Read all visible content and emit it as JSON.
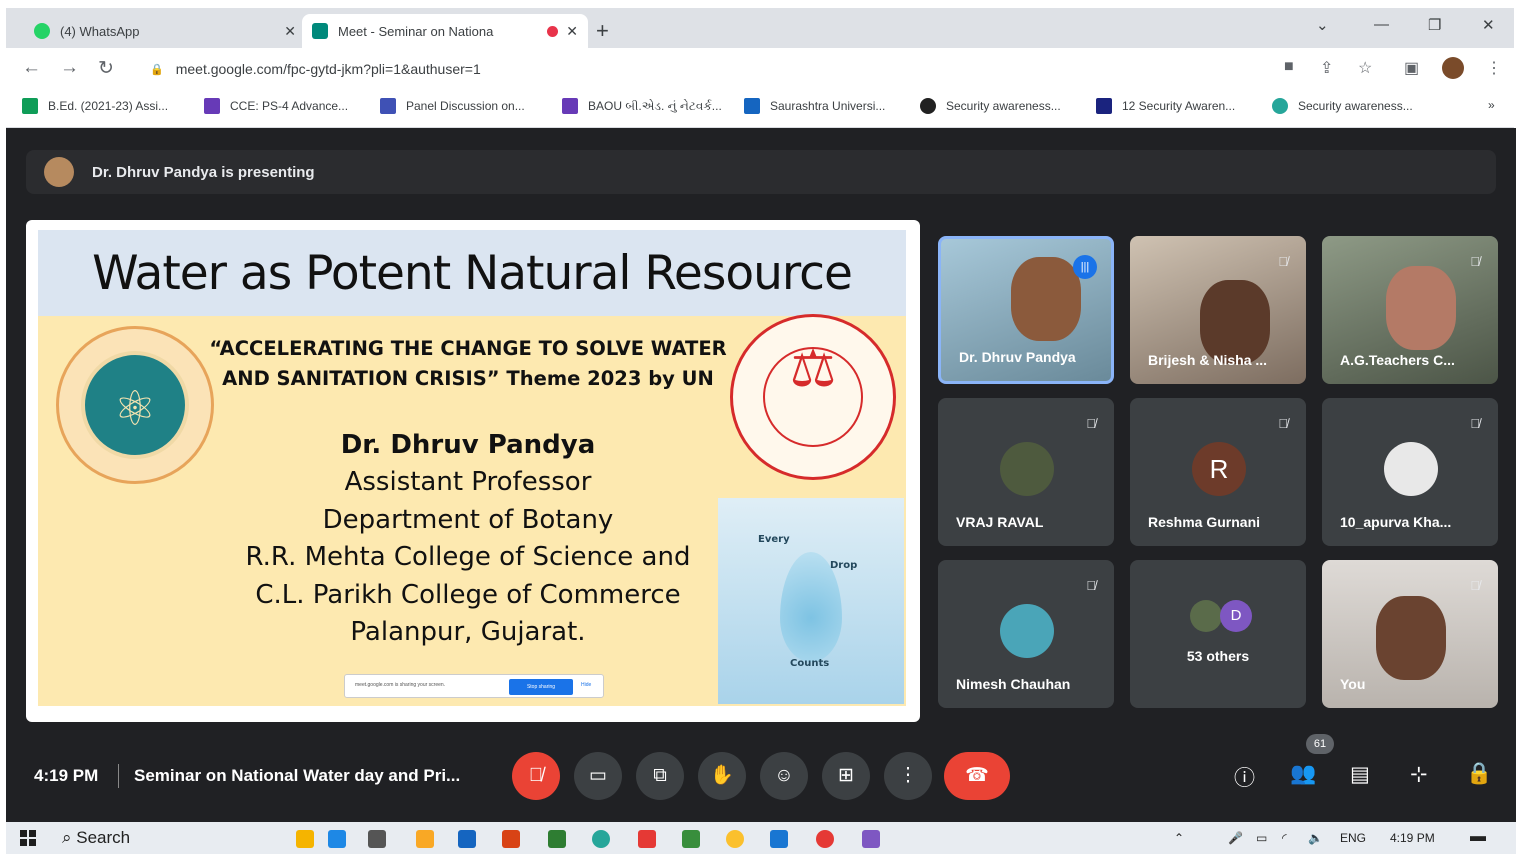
{
  "browser": {
    "tabs": [
      {
        "label": "(4) WhatsApp",
        "color": "#25d366"
      },
      {
        "label": "Meet - Seminar on Nationa",
        "color": "#00897b",
        "active": true
      }
    ],
    "url": "meet.google.com/fpc-gytd-jkm?pli=1&authuser=1",
    "bookmarks": [
      {
        "label": "B.Ed. (2021-23) Assi...",
        "color": "#0f9d58"
      },
      {
        "label": "CCE: PS-4 Advance...",
        "color": "#673ab7"
      },
      {
        "label": "Panel Discussion on...",
        "color": "#3f51b5"
      },
      {
        "label": "BAOU બી.એડ. નું નેટવર્ક...",
        "color": "#673ab7"
      },
      {
        "label": "Saurashtra Universi...",
        "color": "#1565c0"
      },
      {
        "label": "Security awareness...",
        "color": "#212121"
      },
      {
        "label": "12 Security Awaren...",
        "color": "#1a237e"
      },
      {
        "label": "Security awareness...",
        "color": "#26a69a"
      }
    ]
  },
  "meet": {
    "presenting_text": "Dr. Dhruv Pandya is presenting",
    "slide": {
      "title": "Water as Potent Natural Resource",
      "theme_line1": "“ACCELERATING THE CHANGE TO SOLVE WATER",
      "theme_line2": "AND SANITATION CRISIS” Theme 2023 by UN",
      "author_name": "Dr. Dhruv Pandya",
      "author_lines": [
        "Assistant Professor",
        "Department of Botany",
        "R.R. Mehta College of Science and",
        "C.L. Parikh College of Commerce",
        "Palanpur, Gujarat."
      ],
      "poster_words": [
        "Every",
        "Drop",
        "Counts"
      ],
      "share_notice": "meet.google.com is sharing your screen.",
      "share_stop": "Stop sharing",
      "share_hide": "Hide"
    },
    "participants": [
      {
        "name": "Dr. Dhruv Pandya",
        "speaking": true,
        "video": true
      },
      {
        "name": "Brijesh & Nisha ...",
        "muted": true,
        "video": true
      },
      {
        "name": "A.G.Teachers C...",
        "muted": true,
        "video": true
      },
      {
        "name": "VRAJ RAVAL",
        "muted": true
      },
      {
        "name": "Reshma Gurnani",
        "muted": true,
        "initial": "R"
      },
      {
        "name": "10_apurva Kha...",
        "muted": true
      },
      {
        "name": "Nimesh Chauhan",
        "muted": true
      },
      {
        "name": "53 others",
        "initial": "D"
      },
      {
        "name": "You",
        "muted": true,
        "video": true
      }
    ],
    "time": "4:19 PM",
    "meeting_title": "Seminar on National Water day and Pri...",
    "people_count": "61"
  },
  "taskbar": {
    "search": "Search",
    "lang": "ENG",
    "time": "4:19 PM"
  }
}
